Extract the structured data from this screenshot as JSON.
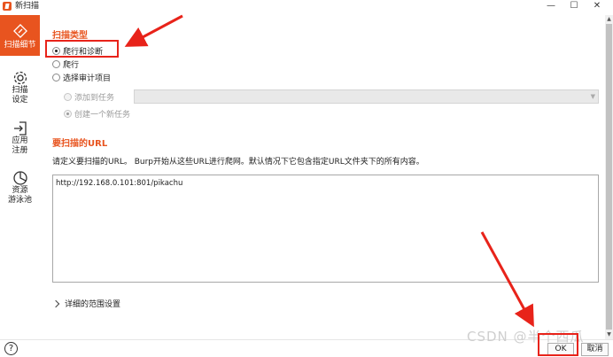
{
  "window": {
    "title": "新扫描",
    "controls": [
      "—",
      "☐",
      "✕"
    ]
  },
  "sidebar": {
    "items": [
      {
        "label_lines": [
          "扫描细节"
        ],
        "icon": "scan-details-icon",
        "active": true
      },
      {
        "label_lines": [
          "扫描",
          "设定"
        ],
        "icon": "gear-icon",
        "active": false
      },
      {
        "label_lines": [
          "应用",
          "注册"
        ],
        "icon": "login-icon",
        "active": false
      },
      {
        "label_lines": [
          "资源",
          "游泳池"
        ],
        "icon": "pie-chart-icon",
        "active": false
      }
    ]
  },
  "scan_type": {
    "title": "扫描类型",
    "options": [
      {
        "label": "爬行和诊断",
        "selected": true
      },
      {
        "label": "爬行",
        "selected": false
      },
      {
        "label": "选择审计项目",
        "selected": false
      }
    ],
    "sub_options": [
      {
        "label": "添加到任务",
        "selected": false
      },
      {
        "label": "创建一个新任务",
        "selected": true
      }
    ],
    "task_combo_value": ""
  },
  "urls": {
    "title": "要扫描的URL",
    "description": "请定义要扫描的URL。 Burp开始从这些URL进行爬网。默认情况下它包含指定URL文件夹下的所有内容。",
    "value": "http://192.168.0.101:801/pikachu"
  },
  "detail_scope": {
    "label": "详细的范围设置"
  },
  "footer": {
    "help": "?",
    "ok_label": "OK",
    "cancel_label": "取消"
  },
  "watermark": "CSDN @半个西瓜",
  "colors": {
    "accent": "#e8541f",
    "annotation": "#e8231a"
  }
}
